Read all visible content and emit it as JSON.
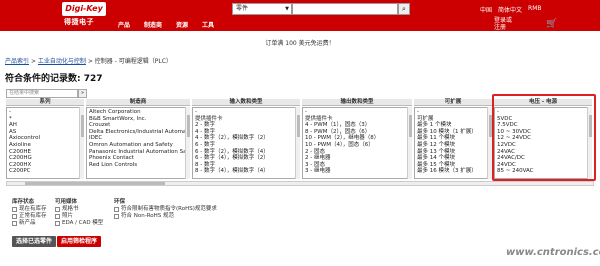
{
  "header": {
    "logo_text": "Digi-Key",
    "logo_sub": "得捷电子",
    "nav": [
      "产品",
      "制造商",
      "资源",
      "工具"
    ],
    "search_scope": "零件",
    "search_placeholder": "",
    "locale": [
      "中国",
      "简体中文",
      "RMB"
    ],
    "login": [
      "登录或",
      "注册"
    ],
    "cart_icon": "cart-icon",
    "colors": {
      "brand": "#cc0000"
    }
  },
  "banner": "订单满 100 美元免运费！",
  "breadcrumb": {
    "links": [
      "产品索引",
      "工业自动化与控制"
    ],
    "sep": ">",
    "current": "控制器 - 可编程逻辑（PLC）"
  },
  "title": "符合条件的记录数: 727",
  "filter": {
    "placeholder": "在结果中搜索",
    "button": "»"
  },
  "facets": [
    {
      "header": "系列",
      "items": [
        "-",
        "*",
        "AH",
        "AS",
        "Axiocontrol",
        "Axioline",
        "C200HE",
        "C200HG",
        "C200HX",
        "C200PC"
      ]
    },
    {
      "header": "制造商",
      "items": [
        "Altech Corporation",
        "B&B SmartWorx, Inc.",
        "Crouzet",
        "Delta Electronics/Industrial Automation",
        "IDEC",
        "Omron Automation and Safety",
        "Panasonic Industrial Automation Sales",
        "Phoenix Contact",
        "Red Lion Controls"
      ]
    },
    {
      "header": "输入数和类型",
      "items": [
        "-",
        "提供插件卡",
        "2 - 数字",
        "4 - 数字",
        "4 - 数字（2），模拟数字（2）",
        "6 - 数字",
        "6 - 数字（2），模拟数字（4）",
        "6 - 数字（4），模拟数字（2）",
        "8 - 数字",
        "8 - 数字（4），模拟数字（4）"
      ]
    },
    {
      "header": "输出数和类型",
      "items": [
        "-",
        "提供插件卡",
        "4 - PWM（1），固态（3）",
        "8 - PWM（2），固态（6）",
        "10 - PWM（2），继电器（8）",
        "10 - PWM（4），固态（6）",
        "2 - 固态",
        "2 - 继电器",
        "3 - 固态",
        "3 - 继电器"
      ]
    },
    {
      "header": "可扩展",
      "items": [
        "-",
        "可扩展",
        "最多 1 个模块",
        "最多 10 模块（1 扩展）",
        "最多 11 个模块",
        "最多 12 个模块",
        "最多 13 个模块",
        "最多 14 个模块",
        "最多 15 个模块",
        "最多 16 模块（3 扩展）"
      ]
    },
    {
      "header": "电压 - 电源",
      "items": [
        "-",
        "5VDC",
        "7.5VDC",
        "10 ~ 30VDC",
        "12 ~ 24VDC",
        "12VDC",
        "24VAC",
        "24VAC/DC",
        "24VDC",
        "85 ~ 240VAC"
      ]
    }
  ],
  "options": {
    "stock": {
      "title": "库存状态",
      "items": [
        "现在有库存",
        "正常有库存",
        "新产品"
      ]
    },
    "media": {
      "title": "可用媒体",
      "items": [
        "规格书",
        "照片",
        "EDA / CAD 模型"
      ]
    },
    "env": {
      "title": "环保",
      "items": [
        "符合限制有害物质指令(RoHS)规范要求",
        "符合 Non-RoHS 规范"
      ]
    }
  },
  "buttons": {
    "apply": "选择已选零件",
    "reset": "启用筛检程序"
  },
  "watermark": "www.cntronics.com"
}
